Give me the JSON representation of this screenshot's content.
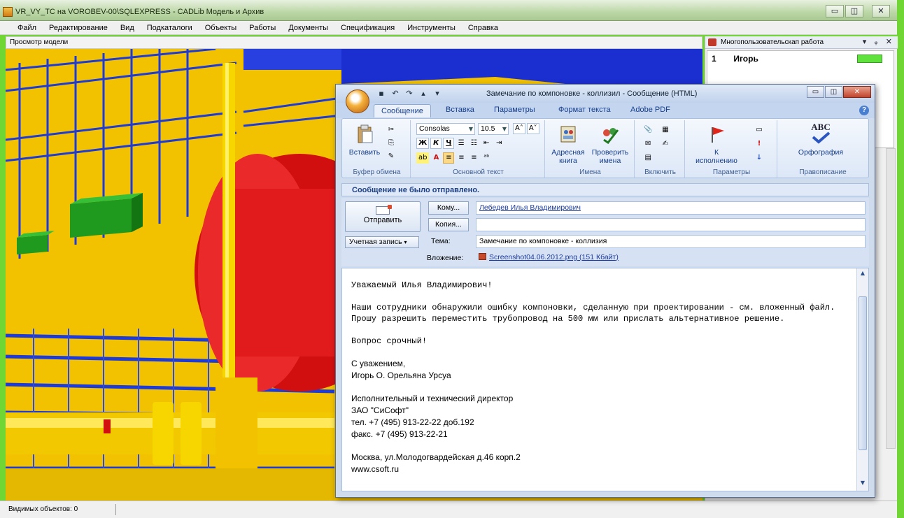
{
  "app": {
    "title": "VR_VY_TC  на VOROBEV-00\\SQLEXPRESS - CADLib Модель и Архив",
    "window_controls": [
      "▭",
      "◫",
      "✕"
    ]
  },
  "menu": [
    "Файл",
    "Редактирование",
    "Вид",
    "Подкаталоги",
    "Объекты",
    "Работы",
    "Документы",
    "Спецификация",
    "Инструменты",
    "Справка"
  ],
  "viewer": {
    "title": "Просмотр модели"
  },
  "collab_panel": {
    "title": "Многопользовательскап работа",
    "controls": "▾ ᵩ ✕",
    "users": [
      {
        "num": "1",
        "name": "Игорь",
        "status_color": "#5fe33c"
      }
    ]
  },
  "status": {
    "visible_objects": "Видимых объектов: 0"
  },
  "message": {
    "window_title": "Замечание по компоновке - коллизил - Сообщение (HTML)",
    "tabs": [
      "Сообщение",
      "Вставка",
      "Параметры",
      "Формат текста",
      "Adobe PDF"
    ],
    "ribbon": {
      "paste": "Вставить",
      "clipboard_group": "Буфер обмена",
      "font_name": "Consolas",
      "font_size": "10.5",
      "bold": "Ж",
      "italic": "К",
      "underline": "Ч",
      "basic_text_group": "Основной текст",
      "address_book": "Адресная книга",
      "check_names": "Проверить имена",
      "names_group": "Имена",
      "include_group": "Включить",
      "followup": "К исполнению",
      "options_group": "Параметры",
      "spelling": "Орфография",
      "proofing_group": "Правописание",
      "abc": "ABC"
    },
    "notice": "Сообщение не было отправлено.",
    "send": "Отправить",
    "account": "Учетная запись",
    "to_button": "Кому...",
    "to_value": "Лебедев Илья Владимирович",
    "cc_button": "Копия...",
    "cc_value": "",
    "subject_label": "Тема:",
    "subject_value": "Замечание по компоновке - коллизия",
    "attachment_label": "Вложение:",
    "attachment_value": "Screenshot04.06.2012.png (151 Кбайт)",
    "body": {
      "greeting": "Уважаемый Илья Владимирович!",
      "para1": "Наши сотрудники обнаружили ошибку компоновки, сделанную при проектировании - см. вложенный файл.",
      "para2": "Прошу разрешить переместить трубопровод на 500 мм или прислать альтернативное решение.",
      "urgent": "Вопрос срочный!",
      "regards": "С уважением,",
      "signer": "Игорь О. Орельяна Урсуа",
      "position": "Исполнительный и технический директор",
      "company": "ЗАО \"СиСофт\"",
      "phone": "тел. +7 (495) 913-22-22 доб.192",
      "fax": "факс. +7 (495) 913-22-21",
      "address": "Москва, ул.Молодогвардейская д.46 корп.2",
      "site": "www.csoft.ru"
    }
  }
}
